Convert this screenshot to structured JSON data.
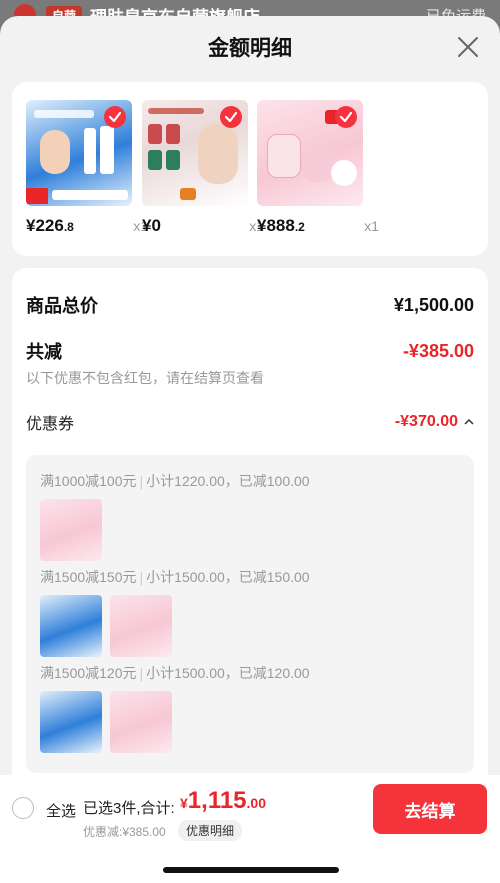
{
  "background": {
    "tag": "自营",
    "store_name": "理肤泉京东自营旗舰店",
    "right_text": "已免运费"
  },
  "sheet": {
    "title": "金额明细"
  },
  "products": [
    {
      "price_int": "¥226",
      "price_dec": ".8",
      "qty": "x1",
      "thumb": "product-blue"
    },
    {
      "price_int": "¥0",
      "price_dec": "",
      "qty": "x1",
      "thumb": "product-mask"
    },
    {
      "price_int": "¥888",
      "price_dec": ".2",
      "qty": "x1",
      "thumb": "product-pink"
    }
  ],
  "summary": {
    "total_label": "商品总价",
    "total_value": "¥1,500.00",
    "reduce_label": "共减",
    "reduce_value": "-¥385.00",
    "reduce_note": "以下优惠不包含红包，请在结算页查看",
    "coupon_label": "优惠券",
    "coupon_value": "-¥370.00"
  },
  "coupon_groups": [
    {
      "rule": "满1000减100元",
      "detail": "小计1220.00，已减100.00",
      "items": [
        "product-pink"
      ]
    },
    {
      "rule": "满1500减150元",
      "detail": "小计1500.00，已减150.00",
      "items": [
        "product-blue",
        "product-pink"
      ]
    },
    {
      "rule": "满1500减120元",
      "detail": "小计1500.00，已减120.00",
      "items": [
        "product-blue",
        "product-pink"
      ]
    }
  ],
  "bottom": {
    "select_all": "全选",
    "selected": "已选3件,合计:",
    "currency": "¥",
    "total_int": "1,115",
    "total_dec": ".00",
    "discount": "优惠减:¥385.00",
    "detail_chip": "优惠明细",
    "checkout": "去结算"
  },
  "colors": {
    "accent": "#f4333a",
    "text_red": "#e8262a",
    "check": "#f5333f"
  }
}
